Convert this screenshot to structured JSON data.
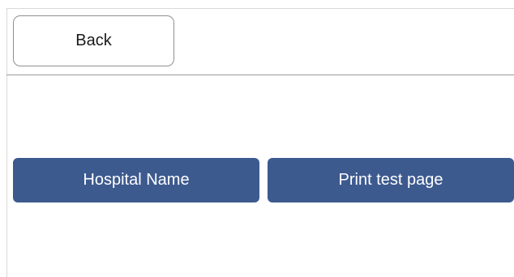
{
  "header": {
    "back_label": "Back"
  },
  "actions": {
    "hospital_name_label": "Hospital Name",
    "print_test_page_label": "Print test page"
  },
  "colors": {
    "primary_button": "#3d5a8f",
    "background": "#ffffff"
  }
}
